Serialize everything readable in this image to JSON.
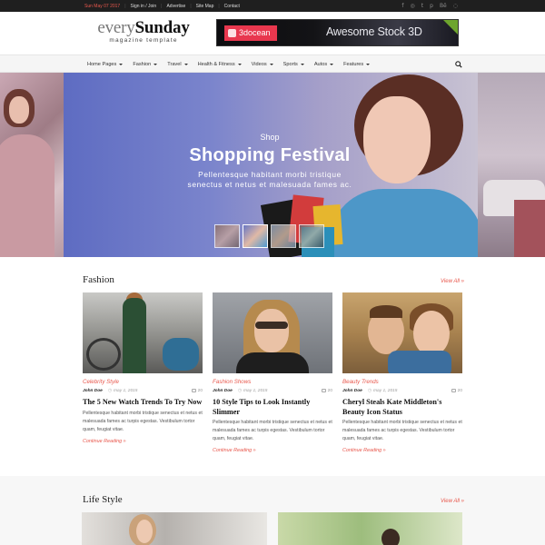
{
  "topbar": {
    "date": "Sun May 07 2017",
    "links": [
      "Sign in / Join",
      "Advertise",
      "Site Map",
      "Contact"
    ],
    "social_icons": [
      "facebook-icon",
      "rss-icon",
      "twitter-icon",
      "pinterest-icon",
      "behance-icon",
      "dribbble-icon"
    ],
    "social_glyphs": [
      "f",
      "◎",
      "t",
      "p",
      "Bē",
      "◌"
    ]
  },
  "logo": {
    "thin": "every",
    "bold": "Sunday",
    "tagline": "magazine template"
  },
  "ad_banner": {
    "brand": "3docean",
    "text": "Awesome Stock 3D"
  },
  "nav": {
    "items": [
      {
        "label": "Home Pages"
      },
      {
        "label": "Fashion"
      },
      {
        "label": "Travel"
      },
      {
        "label": "Health & Fitness"
      },
      {
        "label": "Videos"
      },
      {
        "label": "Sports"
      },
      {
        "label": "Autos"
      },
      {
        "label": "Features"
      }
    ]
  },
  "slider": {
    "category": "Shop",
    "title": "Shopping Festival",
    "description_line1": "Pellentesque habitant morbi tristique",
    "description_line2": "senectus et netus et malesuada fames ac.",
    "thumb_count": 4,
    "active_thumb": 2
  },
  "fashion": {
    "title": "Fashion",
    "view_all": "View All »",
    "cards": [
      {
        "category": "Celebrity Style",
        "author": "John Doe",
        "date": "may 1, 2015",
        "comments": "20",
        "title": "The 5 New Watch Trends To Try Now",
        "excerpt": "Pellentesque habitant morbi tristique senectus et netus et malesuada fames ac turpis egestas. Vestibulum tortor quam, feugiat vitae.",
        "more": "Continue Reading »"
      },
      {
        "category": "Fashion Shows",
        "author": "John Doe",
        "date": "may 1, 2015",
        "comments": "20",
        "title": "10 Style Tips to Look Instantly Slimmer",
        "excerpt": "Pellentesque habitant morbi tristique senectus et netus et malesuada fames ac turpis egestas. Vestibulum tortor quam, feugiat vitae.",
        "more": "Continue Reading »"
      },
      {
        "category": "Beauty Trends",
        "author": "John Doe",
        "date": "may 1, 2015",
        "comments": "20",
        "title": "Cheryl Steals Kate Middleton's Beauty Icon Status",
        "excerpt": "Pellentesque habitant morbi tristique senectus et netus et malesuada fames ac turpis egestas. Vestibulum tortor quam, feugiat vitae.",
        "more": "Continue Reading »"
      }
    ]
  },
  "lifestyle": {
    "title": "Life Style",
    "view_all": "View All »"
  },
  "colors": {
    "accent": "#e8584d",
    "topbar_bg": "#1f1f1f",
    "nav_bg": "#f5f5f5",
    "slide_overlay": "#5e6cc2"
  }
}
